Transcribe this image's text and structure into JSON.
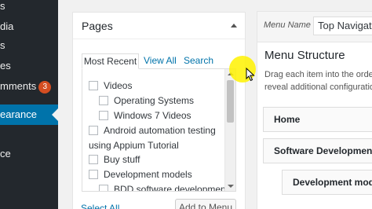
{
  "sidebar": {
    "items": [
      {
        "label": "s"
      },
      {
        "label": "dia"
      },
      {
        "label": "s"
      },
      {
        "label": "es"
      },
      {
        "label": "mments",
        "badge": "3"
      },
      {
        "label": "earance",
        "active": true
      },
      {
        "label": ""
      },
      {
        "label": "ce"
      },
      {
        "label": ""
      },
      {
        "label": ""
      }
    ]
  },
  "pages_box": {
    "title": "Pages",
    "tabs": {
      "recent": "Most Recent",
      "all": "View All",
      "search": "Search"
    },
    "items": [
      {
        "label": "Videos"
      },
      {
        "label": "Operating Systems"
      },
      {
        "label": "Windows 7 Videos"
      },
      {
        "label": "Android automation testing",
        "label_line2": "using Appium Tutorial"
      },
      {
        "label": "Buy stuff"
      },
      {
        "label": "Development models"
      },
      {
        "label": "BDD software development"
      }
    ],
    "select_all": "Select All",
    "add_button": "Add to Menu"
  },
  "menu_name": {
    "label": "Menu Name",
    "value": "Top Navigation"
  },
  "menu_structure": {
    "title": "Menu Structure",
    "description": "Drag each item into the order\nreveal additional configuration",
    "items": [
      {
        "label": "Home"
      },
      {
        "label": "Software Development"
      },
      {
        "label": "Development models"
      }
    ]
  },
  "colors": {
    "sidebar_bg": "#23282d",
    "active_bg": "#0073aa",
    "link": "#0073aa",
    "badge": "#d54e21",
    "cursor_highlight": "#fff200"
  }
}
